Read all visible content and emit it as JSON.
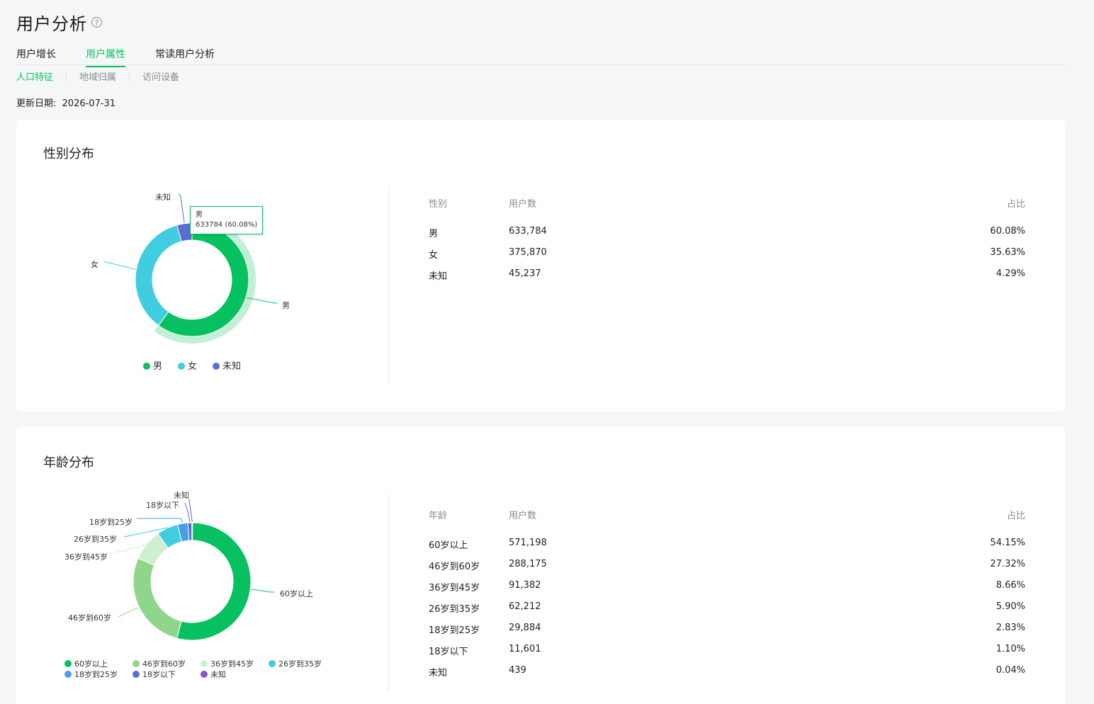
{
  "header": {
    "title": "用户分析",
    "help_icon": "?"
  },
  "tabs": [
    {
      "label": "用户增长",
      "active": false
    },
    {
      "label": "用户属性",
      "active": true
    },
    {
      "label": "常读用户分析",
      "active": false
    }
  ],
  "subtabs": [
    {
      "label": "人口特征",
      "active": true
    },
    {
      "label": "地域归属",
      "active": false
    },
    {
      "label": "访问设备",
      "active": false
    }
  ],
  "update": {
    "label": "更新日期:",
    "date": "2026-07-31"
  },
  "gender": {
    "title": "性别分布",
    "tooltip": {
      "name": "男",
      "value": "633784 (60.08%)"
    },
    "table": {
      "headers": [
        "性别",
        "用户数",
        "占比"
      ],
      "rows": [
        {
          "name": "男",
          "count": "633,784",
          "pct": "60.08%"
        },
        {
          "name": "女",
          "count": "375,870",
          "pct": "35.63%"
        },
        {
          "name": "未知",
          "count": "45,237",
          "pct": "4.29%"
        }
      ]
    }
  },
  "age": {
    "title": "年龄分布",
    "table": {
      "headers": [
        "年龄",
        "用户数",
        "占比"
      ],
      "rows": [
        {
          "name": "60岁以上",
          "count": "571,198",
          "pct": "54.15%"
        },
        {
          "name": "46岁到60岁",
          "count": "288,175",
          "pct": "27.32%"
        },
        {
          "name": "36岁到45岁",
          "count": "91,382",
          "pct": "8.66%"
        },
        {
          "name": "26岁到35岁",
          "count": "62,212",
          "pct": "5.90%"
        },
        {
          "name": "18岁到25岁",
          "count": "29,884",
          "pct": "2.83%"
        },
        {
          "name": "18岁以下",
          "count": "11,601",
          "pct": "1.10%"
        },
        {
          "name": "未知",
          "count": "439",
          "pct": "0.04%"
        }
      ]
    }
  },
  "chart_data": [
    {
      "type": "pie",
      "title": "性别分布",
      "categories": [
        "男",
        "女",
        "未知"
      ],
      "values": [
        633784,
        375870,
        45237
      ],
      "colors": [
        "#07c160",
        "#40cde0",
        "#5b6ecf"
      ],
      "highlight": "男",
      "legend": "bottom"
    },
    {
      "type": "pie",
      "title": "年龄分布",
      "categories": [
        "60岁以上",
        "46岁到60岁",
        "36岁到45岁",
        "26岁到35岁",
        "18岁到25岁",
        "18岁以下",
        "未知"
      ],
      "values": [
        571198,
        288175,
        91382,
        62212,
        29884,
        11601,
        439
      ],
      "colors": [
        "#07c160",
        "#8fd68b",
        "#cdefd0",
        "#40cde0",
        "#4a9ee8",
        "#5b6ecf",
        "#8a4fd9"
      ],
      "legend": "bottom"
    }
  ]
}
